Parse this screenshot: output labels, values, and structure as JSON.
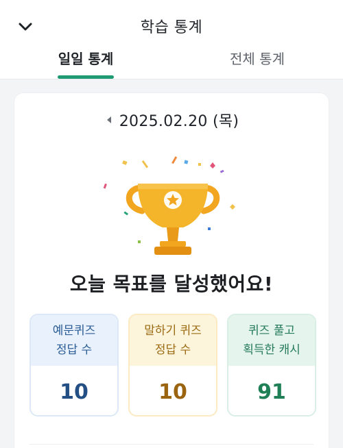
{
  "header": {
    "title": "학습 통계",
    "tabs": [
      {
        "label": "일일 통계",
        "active": true
      },
      {
        "label": "전체 통계",
        "active": false
      }
    ],
    "accent_color": "#1e9b73"
  },
  "card": {
    "date": "2025.02.20 (목)",
    "message": "오늘 목표를 달성했어요!",
    "stats": [
      {
        "line1": "예문퀴즈",
        "line2": "정답 수",
        "value": "10",
        "color": "#244f85"
      },
      {
        "line1": "말하기 퀴즈",
        "line2": "정답 수",
        "value": "10",
        "color": "#9a6410"
      },
      {
        "line1": "퀴즈 풀고",
        "line2": "획득한 캐시",
        "value": "91",
        "color": "#1f7f56"
      }
    ]
  },
  "icons": {
    "back": "chevron-down-icon",
    "prev_date": "caret-left-icon",
    "trophy": "trophy-icon"
  }
}
